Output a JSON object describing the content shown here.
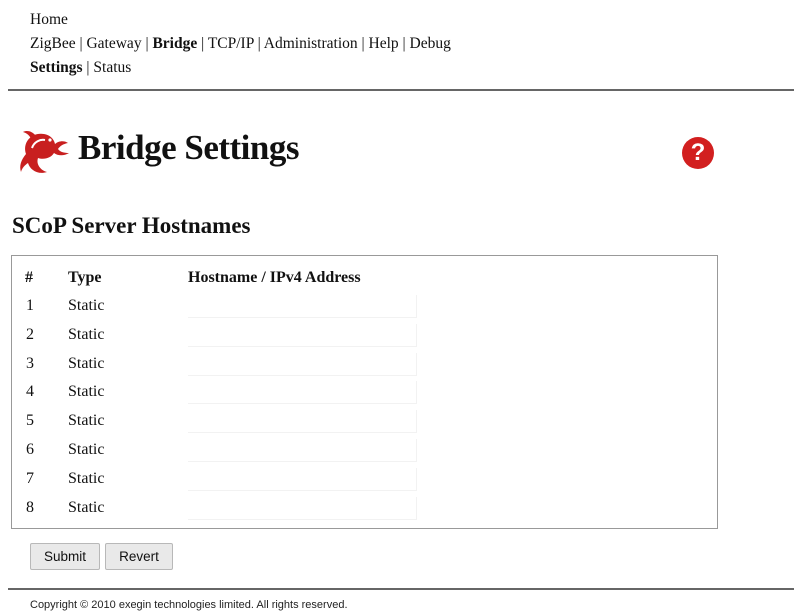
{
  "nav": {
    "row1": [
      {
        "label": "Home",
        "active": false
      }
    ],
    "row2": [
      {
        "label": "ZigBee",
        "active": false
      },
      {
        "label": "Gateway",
        "active": false
      },
      {
        "label": "Bridge",
        "active": true
      },
      {
        "label": "TCP/IP",
        "active": false
      },
      {
        "label": "Administration",
        "active": false
      },
      {
        "label": "Help",
        "active": false
      },
      {
        "label": "Debug",
        "active": false
      }
    ],
    "row3": [
      {
        "label": "Settings",
        "active": true
      },
      {
        "label": "Status",
        "active": false
      }
    ],
    "separator": "|"
  },
  "header": {
    "title": "Bridge Settings",
    "logo_icon": "lizard-logo-icon",
    "help_label": "?",
    "help_icon": "help-question-icon",
    "accent_color": "#d21f1f"
  },
  "section": {
    "title": "SCoP Server Hostnames"
  },
  "table": {
    "headers": {
      "num": "#",
      "type": "Type",
      "host": "Hostname / IPv4 Address"
    },
    "rows": [
      {
        "num": "1",
        "type": "Static",
        "host": ""
      },
      {
        "num": "2",
        "type": "Static",
        "host": ""
      },
      {
        "num": "3",
        "type": "Static",
        "host": ""
      },
      {
        "num": "4",
        "type": "Static",
        "host": ""
      },
      {
        "num": "5",
        "type": "Static",
        "host": ""
      },
      {
        "num": "6",
        "type": "Static",
        "host": ""
      },
      {
        "num": "7",
        "type": "Static",
        "host": ""
      },
      {
        "num": "8",
        "type": "Static",
        "host": ""
      }
    ]
  },
  "buttons": {
    "submit": "Submit",
    "revert": "Revert"
  },
  "footer": {
    "copyright": "Copyright © 2010 exegin technologies limited. All rights reserved."
  }
}
